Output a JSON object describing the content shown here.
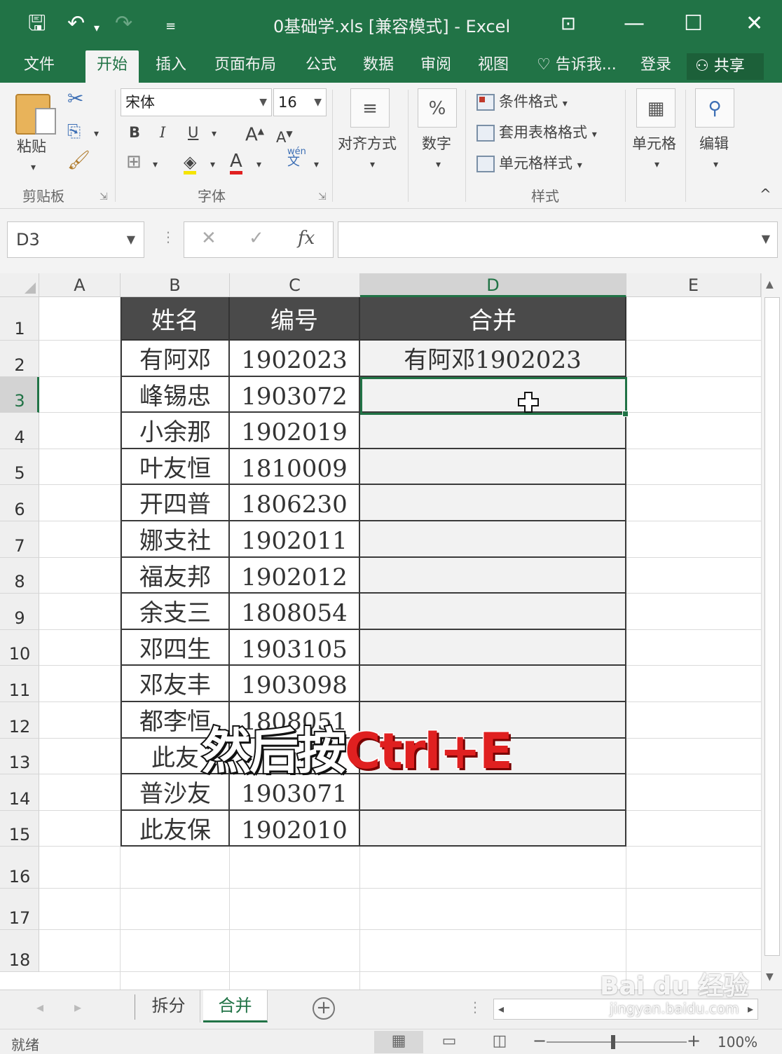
{
  "window": {
    "title": "0基础学.xls  [兼容模式] - Excel",
    "minimize_icon": "minimize-icon",
    "maximize_icon": "maximize-icon",
    "close_icon": "close-icon"
  },
  "menu": {
    "tabs": [
      "文件",
      "开始",
      "插入",
      "页面布局",
      "公式",
      "数据",
      "审阅",
      "视图"
    ],
    "active_tab": "开始",
    "tell_me": "告诉我...",
    "login": "登录",
    "share": "共享"
  },
  "ribbon": {
    "paste": "粘贴",
    "clipboard_label": "剪贴板",
    "font_name": "宋体",
    "font_size": "16",
    "bold": "B",
    "italic": "I",
    "underline": "U",
    "font_label": "字体",
    "align": "对齐方式",
    "number": "数字",
    "cond_format": "条件格式",
    "table_format": "套用表格格式",
    "cell_style": "单元格样式",
    "styles_label": "样式",
    "cells": "单元格",
    "edit": "编辑",
    "phonetic": "wén"
  },
  "formula_bar": {
    "name_box": "D3",
    "formula": ""
  },
  "grid": {
    "columns": [
      "A",
      "B",
      "C",
      "D",
      "E"
    ],
    "selected_column": "D",
    "rows": [
      "1",
      "2",
      "3",
      "4",
      "5",
      "6",
      "7",
      "8",
      "9",
      "10",
      "11",
      "12",
      "13",
      "14",
      "15",
      "16",
      "17",
      "18"
    ],
    "selected_row": "3",
    "headers": [
      "姓名",
      "编号",
      "合并"
    ],
    "data": [
      {
        "name": "有阿邓",
        "id": "1902023",
        "merged": "有阿邓1902023"
      },
      {
        "name": "峰锡忠",
        "id": "1903072",
        "merged": ""
      },
      {
        "name": "小余那",
        "id": "1902019",
        "merged": ""
      },
      {
        "name": "叶友恒",
        "id": "1810009",
        "merged": ""
      },
      {
        "name": "开四普",
        "id": "1806230",
        "merged": ""
      },
      {
        "name": "娜支社",
        "id": "1902011",
        "merged": ""
      },
      {
        "name": "福友邦",
        "id": "1902012",
        "merged": ""
      },
      {
        "name": "余支三",
        "id": "1808054",
        "merged": ""
      },
      {
        "name": "邓四生",
        "id": "1903105",
        "merged": ""
      },
      {
        "name": "邓友丰",
        "id": "1903098",
        "merged": ""
      },
      {
        "name": "都李恒",
        "id": "1808051",
        "merged": ""
      },
      {
        "name": "此友",
        "id": "",
        "merged": ""
      },
      {
        "name": "普沙友",
        "id": "1903071",
        "merged": ""
      },
      {
        "name": "此友保",
        "id": "1902010",
        "merged": ""
      }
    ]
  },
  "overlay": {
    "text_white": "然后按",
    "text_red": "Ctrl+E"
  },
  "sheets": {
    "tabs": [
      "拆分",
      "合并"
    ],
    "active": "合并"
  },
  "status": {
    "ready": "就绪",
    "zoom": "100%"
  },
  "watermark": {
    "brand": "Bai du 经验",
    "url": "jingyan.baidu.com"
  },
  "colors": {
    "accent": "#217346",
    "header_fill": "#4a4a4a",
    "overlay_red": "#e02020"
  }
}
